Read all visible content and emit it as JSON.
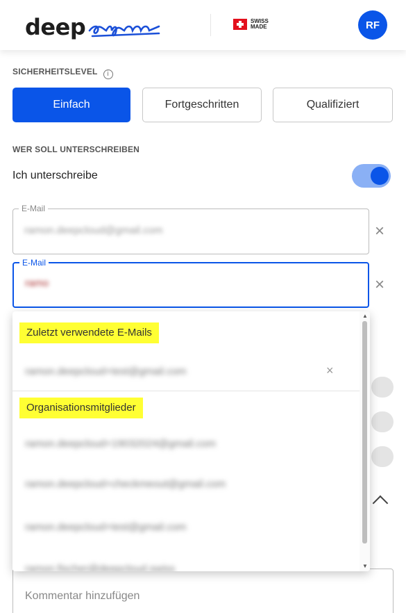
{
  "header": {
    "logo_word": "deep",
    "logo_script": "sign",
    "swiss_line1": "SWISS",
    "swiss_line2": "MADE",
    "avatar_initials": "RF"
  },
  "security": {
    "label": "SICHERHEITSLEVEL",
    "info_glyph": "i",
    "options": [
      "Einfach",
      "Fortgeschritten",
      "Qualifiziert"
    ],
    "selected": "Einfach"
  },
  "signers": {
    "label": "WER SOLL UNTERSCHREIBEN",
    "self_sign_label": "Ich unterschreibe",
    "self_sign_on": true
  },
  "email_fields": [
    {
      "legend": "E-Mail",
      "value": "ramon.deepcloud@gmail.com"
    },
    {
      "legend": "E-Mail",
      "value": "ramo"
    }
  ],
  "clear_glyph": "×",
  "dropdown": {
    "recent_header": "Zuletzt verwendete E-Mails",
    "recent_items": [
      "ramon.deepcloud+test@gmail.com"
    ],
    "remove_glyph": "×",
    "org_header": "Organisationsmitglieder",
    "org_items": [
      "ramon.deepcloud+19032024@gmail.com",
      "ramon.deepcloud+checkmeout@gmail.com",
      "ramon.deepcloud+test@gmail.com",
      "ramon.fischer@deepcloud.swiss"
    ]
  },
  "comment": {
    "placeholder": "Kommentar hinzufügen"
  },
  "colors": {
    "accent": "#0a55e8",
    "highlight": "#ffff33",
    "toggle_track": "#8ab0f5"
  },
  "icons": [
    "info-icon",
    "close-icon",
    "chevron-up-icon",
    "swiss-flag-icon"
  ]
}
